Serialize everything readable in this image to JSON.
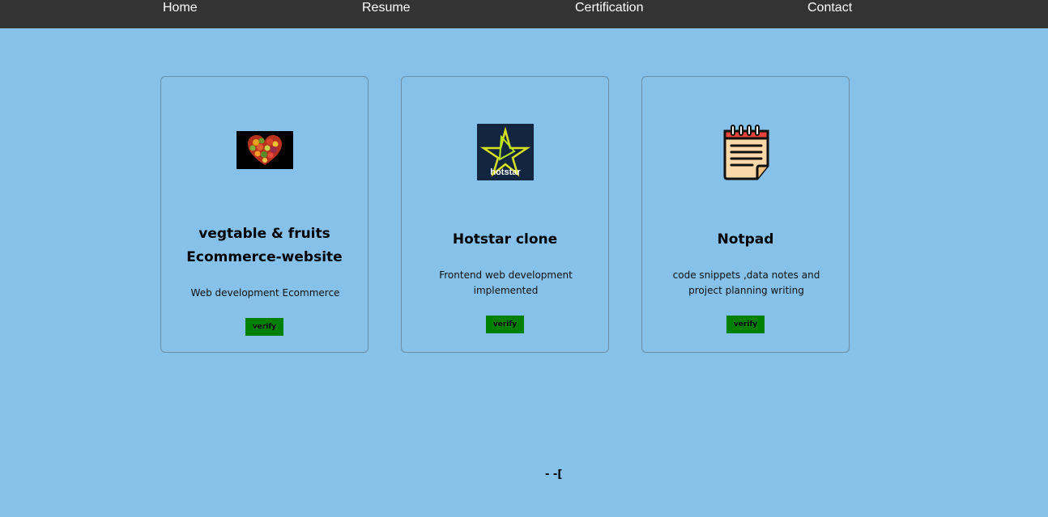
{
  "nav": {
    "items": [
      "Home",
      "Resume",
      "Certification",
      "Contact"
    ]
  },
  "cards": [
    {
      "thumb_icon": "heart-fruits-image",
      "title_line1": "vegtable & fruits",
      "title_line2": "Ecommerce-website",
      "description": "Web development Ecommerce",
      "button_label": "verify"
    },
    {
      "thumb_icon": "hotstar-logo",
      "thumb_text": "hotstar",
      "title_line1": "Hotstar clone",
      "description_line1": "Frontend web development",
      "description_line2": "implemented",
      "button_label": "verify"
    },
    {
      "thumb_icon": "notepad-icon",
      "title_line1": "Notpad",
      "description_line1": "code snippets ,data notes and",
      "description_line2": "project planning writing",
      "button_label": "verify"
    }
  ],
  "footer": {
    "text": "- -["
  },
  "colors": {
    "background": "#85c1e9",
    "nav_background": "#333333",
    "button": "#008000"
  }
}
